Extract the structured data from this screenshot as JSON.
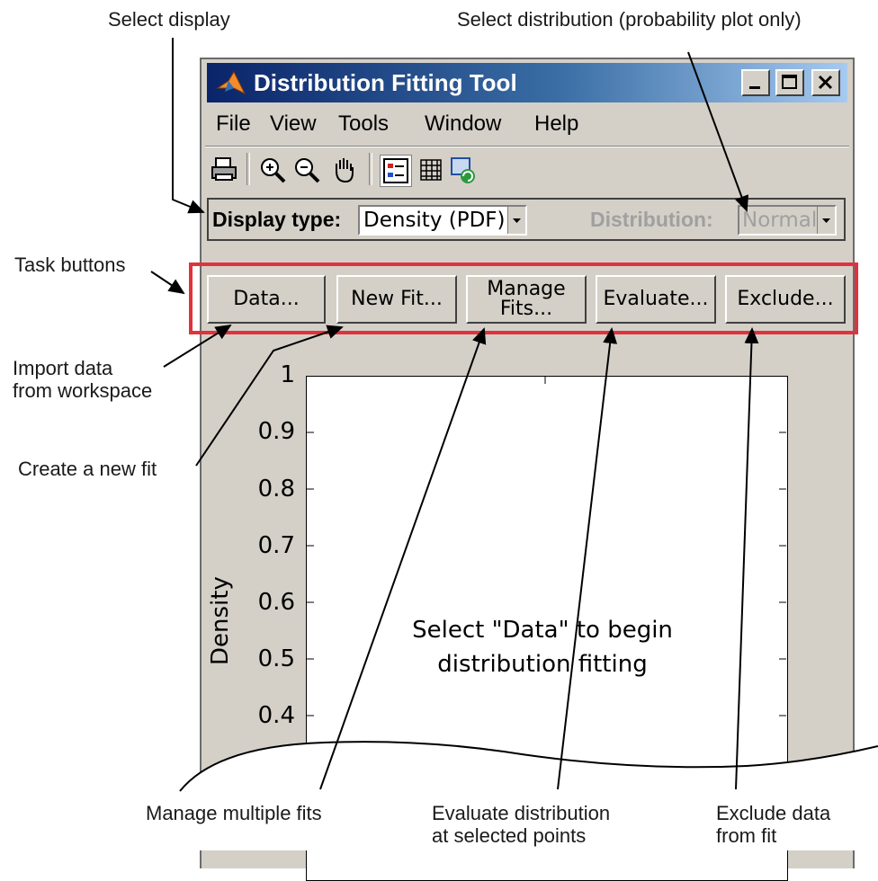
{
  "callouts": {
    "select_display": "Select display",
    "select_distribution": "Select distribution (probability plot only)",
    "task_buttons": "Task buttons",
    "import_data_line1": "Import data",
    "import_data_line2": "from workspace",
    "create_fit": "Create a new fit",
    "manage_fits": "Manage multiple fits",
    "evaluate_line1": "Evaluate distribution",
    "evaluate_line2": "at selected points",
    "exclude_line1": "Exclude data",
    "exclude_line2": "from fit"
  },
  "window": {
    "title": "Distribution Fitting Tool",
    "menu": [
      "File",
      "View",
      "Tools",
      "Window",
      "Help"
    ],
    "toolbar_icons": [
      "print-icon",
      "zoom-in-icon",
      "zoom-out-icon",
      "pan-icon",
      "legend-icon",
      "grid-icon",
      "refresh-icon"
    ],
    "display_type_label": "Display type:",
    "display_type_value": "Density (PDF)",
    "distribution_label": "Distribution:",
    "distribution_value": "Normal",
    "task_buttons": {
      "data": "Data...",
      "new_fit": "New Fit...",
      "manage_fits_line1": "Manage",
      "manage_fits_line2": "Fits...",
      "evaluate": "Evaluate...",
      "exclude": "Exclude..."
    }
  },
  "plot": {
    "ylabel": "Density",
    "yticks": [
      "1",
      "0.9",
      "0.8",
      "0.7",
      "0.6",
      "0.5",
      "0.4"
    ],
    "message_line1": "Select \"Data\" to begin",
    "message_line2": "distribution fitting"
  },
  "colors": {
    "window_bg": "#d4d0c8",
    "titlebar_start": "#0a246a",
    "highlight_frame": "#e0323c"
  }
}
